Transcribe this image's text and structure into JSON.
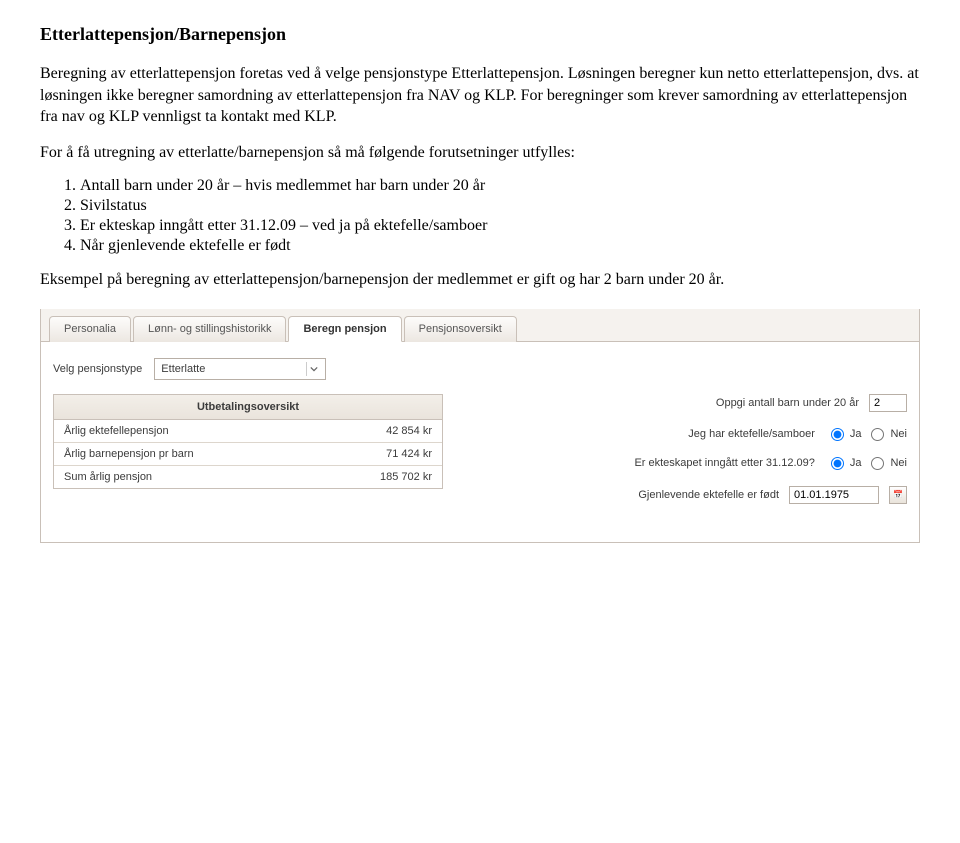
{
  "doc": {
    "title": "Etterlattepensjon/Barnepensjon",
    "para1": "Beregning av etterlattepensjon foretas ved å velge pensjonstype Etterlattepensjon. Løsningen beregner kun netto etterlattepensjon, dvs. at løsningen ikke beregner samordning av etterlattepensjon fra NAV og KLP. For beregninger som krever samordning av etterlattepensjon fra nav og KLP vennligst ta kontakt med KLP.",
    "para2": "For å få utregning av etterlatte/barnepensjon så må følgende forutsetninger utfylles:",
    "list": [
      "Antall barn under 20 år – hvis medlemmet har barn under 20 år",
      "Sivilstatus",
      "Er ekteskap inngått etter 31.12.09 – ved ja på ektefelle/samboer",
      "Når gjenlevende ektefelle er født"
    ],
    "para3": "Eksempel på beregning av etterlattepensjon/barnepensjon der medlemmet er gift og har 2 barn under 20 år."
  },
  "ui": {
    "tabs": [
      {
        "label": "Personalia"
      },
      {
        "label": "Lønn- og stillingshistorikk"
      },
      {
        "label": "Beregn pensjon"
      },
      {
        "label": "Pensjonsoversikt"
      }
    ],
    "active_tab_index": 2,
    "select_label": "Velg pensjonstype",
    "select_value": "Etterlatte",
    "table": {
      "header": "Utbetalingsoversikt",
      "rows": [
        {
          "label": "Årlig ektefellepensjon",
          "value": "42 854 kr"
        },
        {
          "label": "Årlig barnepensjon pr barn",
          "value": "71 424 kr"
        },
        {
          "label": "Sum årlig pensjon",
          "value": "185 702 kr"
        }
      ]
    },
    "form": {
      "barn_label": "Oppgi antall barn under 20 år",
      "barn_value": "2",
      "ektefelle_label": "Jeg har ektefelle/samboer",
      "ja": "Ja",
      "nei": "Nei",
      "ektefelle_selected": "ja",
      "ekteskap_label": "Er ekteskapet inngått etter 31.12.09?",
      "ekteskap_selected": "ja",
      "fodt_label": "Gjenlevende ektefelle er født",
      "fodt_value": "01.01.1975"
    }
  }
}
